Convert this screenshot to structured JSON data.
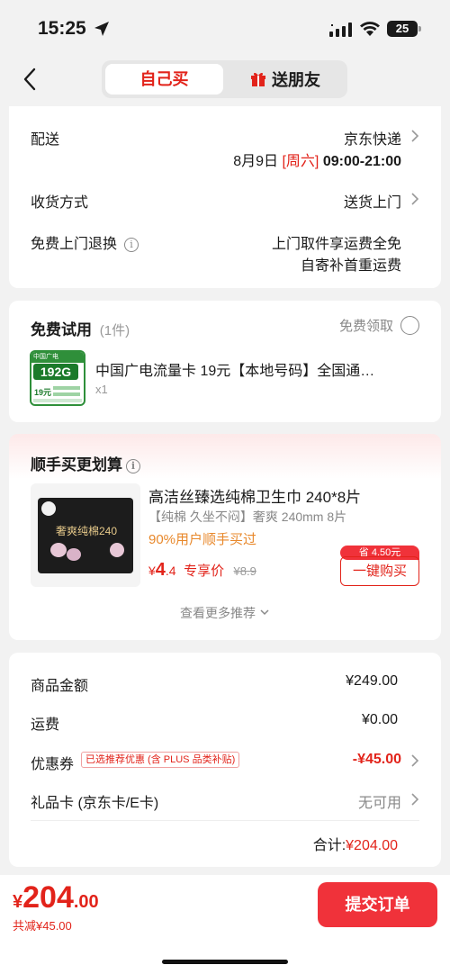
{
  "status": {
    "time": "15:25",
    "battery": "25"
  },
  "nav": {
    "tab_self": "自己买",
    "tab_gift": "送朋友"
  },
  "delivery": {
    "label": "配送",
    "carrier": "京东快递",
    "date": "8月9日",
    "weekday": "[周六]",
    "timeslot": "09:00-21:00",
    "method_label": "收货方式",
    "method_value": "送货上门",
    "return_label": "免费上门退换",
    "return_line1": "上门取件享运费全免",
    "return_line2": "自寄补首重运费"
  },
  "trial": {
    "title": "免费试用",
    "count": "(1件)",
    "claim_label": "免费领取",
    "product_name": "中国广电流量卡 19元【本地号码】全国通…",
    "qty": "x1",
    "thumb_top": "中国广电",
    "thumb_big": "192G",
    "thumb_price": "19元"
  },
  "upsell": {
    "title": "顺手买更划算",
    "product_name": "高洁丝臻选纯棉卫生巾 240*8片",
    "product_desc": "【纯棉 久坐不闷】奢爽 240mm 8片",
    "social_proof": "90%用户顺手买过",
    "price_symbol": "¥",
    "price_int": "4",
    "price_dec": ".4",
    "price_tag": "专享价",
    "orig_price": "¥8.9",
    "save_badge": "省 4.50元",
    "buy_button": "一键购买",
    "more_label": "查看更多推荐",
    "thumb_text": "奢爽纯棉240"
  },
  "summary": {
    "goods_label": "商品金额",
    "goods_value": "¥249.00",
    "shipping_label": "运费",
    "shipping_value": "¥0.00",
    "coupon_label": "优惠券",
    "coupon_tag": "已选推荐优惠 (含 PLUS 品类补贴)",
    "coupon_value": "-¥45.00",
    "giftcard_label": "礼品卡 (京东卡/E卡)",
    "giftcard_value": "无可用",
    "total_label": "合计:",
    "total_value": "¥204.00"
  },
  "bottom": {
    "currency": "¥",
    "amount_int": "204",
    "amount_dec": ".00",
    "savings": "共减¥45.00",
    "submit": "提交订单"
  },
  "colors": {
    "accent": "#e2231a",
    "orange": "#e8882b",
    "background": "#f2f2f2"
  }
}
